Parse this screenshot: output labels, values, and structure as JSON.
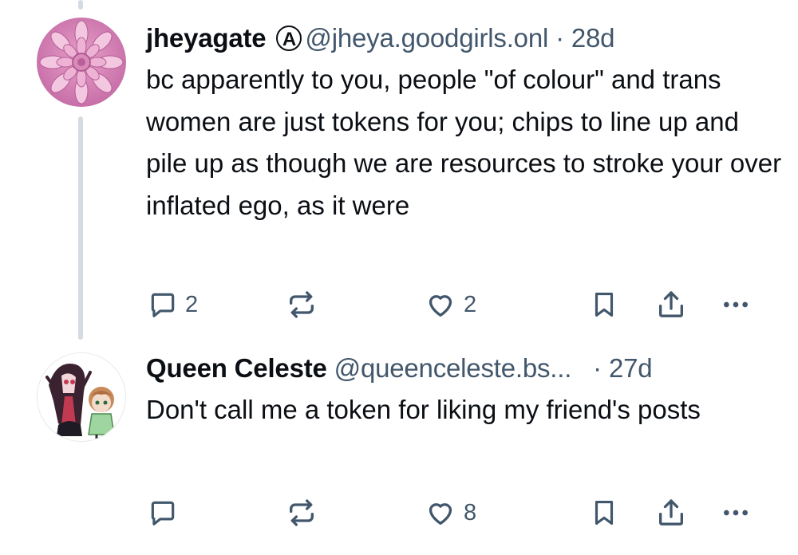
{
  "posts": [
    {
      "display_name": "jheyagate",
      "badge": "A",
      "handle": "@jheya.goodgirls.onl",
      "separator": "·",
      "age": "28d",
      "text": "bc apparently to you, people \"of colour\" and trans women are just tokens for you; chips to line up and pile up as though we are resources to stroke your over inflated ego, as it were",
      "reply_count": "2",
      "repost_count": "",
      "like_count": "2",
      "avatar_icon": "pink-flower-avatar"
    },
    {
      "display_name": "Queen Celeste",
      "handle": "@queenceleste.bs...",
      "separator": "·",
      "age": "27d",
      "text": "Don't call me a token for liking my friend's posts",
      "reply_count": "",
      "repost_count": "",
      "like_count": "8",
      "avatar_icon": "anime-characters-avatar"
    }
  ],
  "colors": {
    "text": "#0b0f14",
    "muted": "#42576c",
    "thread_line": "#d4dbe2",
    "background": "#ffffff"
  },
  "icons": [
    "reply-icon",
    "repost-icon",
    "like-icon",
    "bookmark-icon",
    "share-icon",
    "more-icon"
  ]
}
